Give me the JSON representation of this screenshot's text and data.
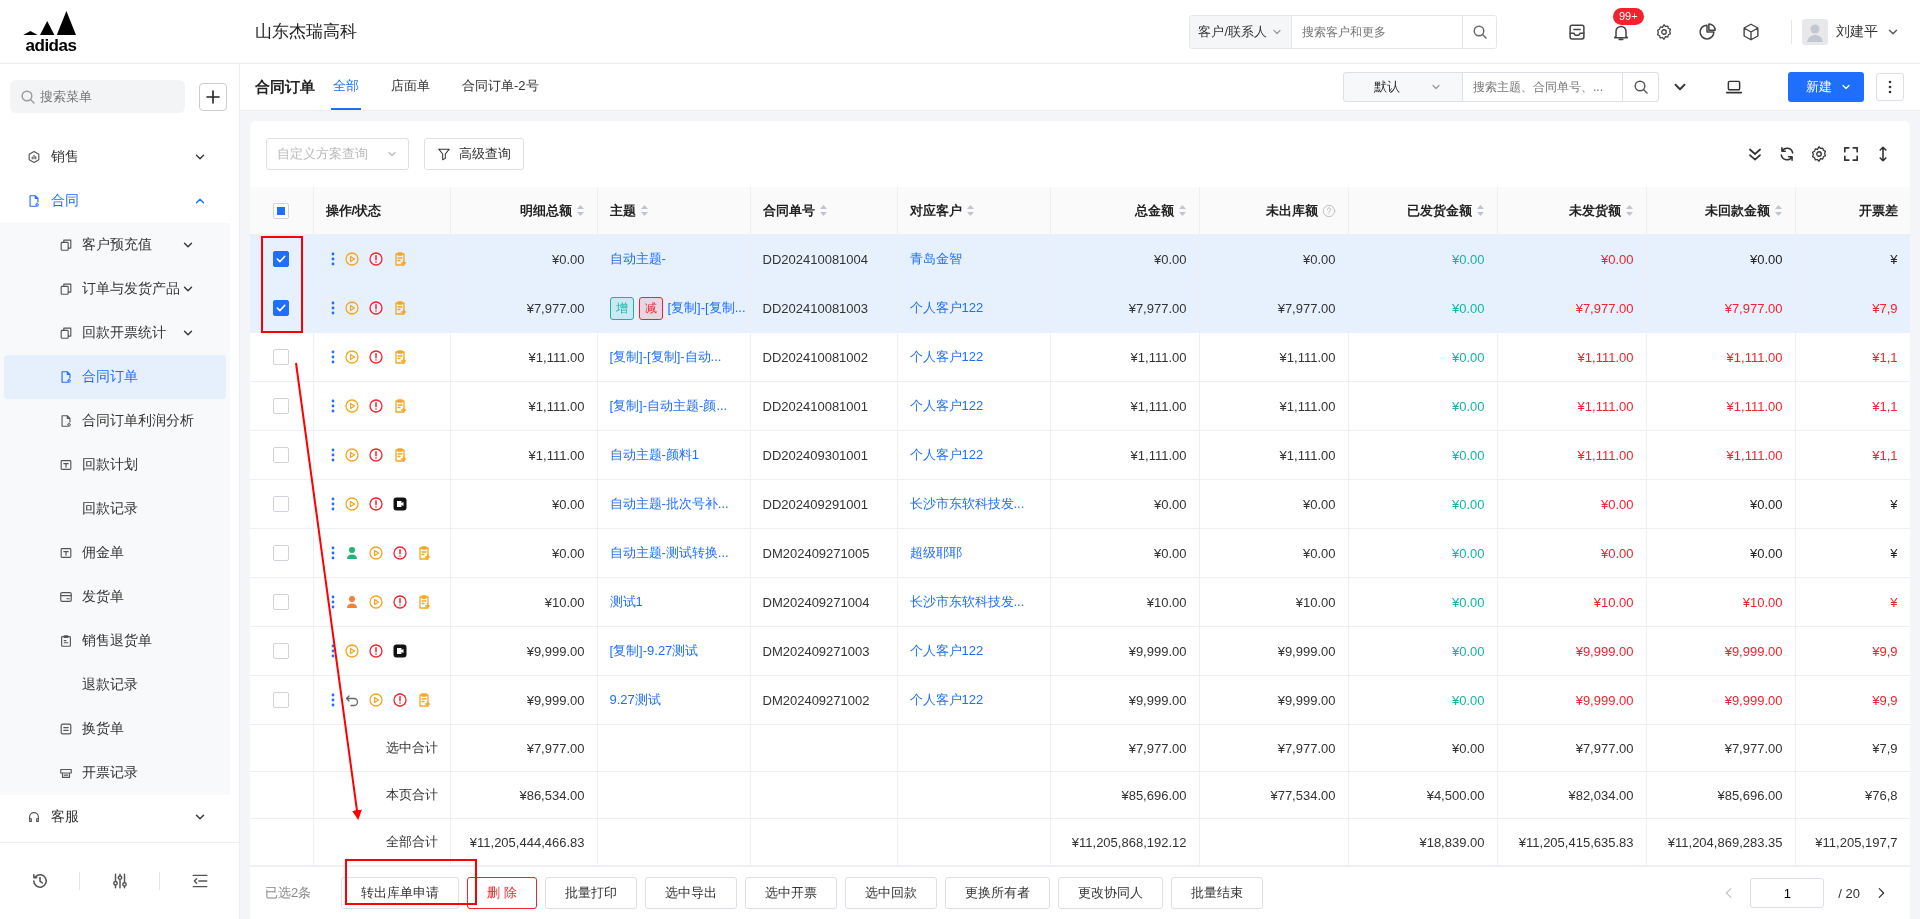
{
  "header": {
    "logo_text": "adidas",
    "company": "山东杰瑞高科",
    "search_scope": "客户/联系人",
    "search_placeholder": "搜索客户和更多",
    "notification_badge": "99+",
    "user_name": "刘建平"
  },
  "sidebar": {
    "search_placeholder": "搜索菜单",
    "items": [
      {
        "label": "销售",
        "expanded": false,
        "selected": false
      },
      {
        "label": "合同",
        "expanded": true,
        "selected": false,
        "children": [
          {
            "label": "客户预充值",
            "expanded": false,
            "selected": false
          },
          {
            "label": "订单与发货产品",
            "expanded": false,
            "selected": false
          },
          {
            "label": "回款开票统计",
            "expanded": false,
            "selected": false
          },
          {
            "label": "合同订单",
            "selected": true
          },
          {
            "label": "合同订单利润分析",
            "selected": false
          },
          {
            "label": "回款计划",
            "selected": false
          },
          {
            "label": "回款记录",
            "selected": false
          },
          {
            "label": "佣金单",
            "selected": false
          },
          {
            "label": "发货单",
            "selected": false
          },
          {
            "label": "销售退货单",
            "selected": false
          },
          {
            "label": "退款记录",
            "selected": false
          },
          {
            "label": "换货单",
            "selected": false
          },
          {
            "label": "开票记录",
            "selected": false
          }
        ]
      },
      {
        "label": "客服",
        "expanded": false,
        "selected": false
      }
    ]
  },
  "page": {
    "title": "合同订单",
    "tabs": [
      {
        "label": "全部",
        "selected": true
      },
      {
        "label": "店面单",
        "selected": false
      },
      {
        "label": "合同订单-2号",
        "selected": false
      }
    ],
    "view_select": "默认",
    "search_placeholder": "搜索主题、合同单号、...",
    "new_button": "新建"
  },
  "filters": {
    "scheme_placeholder": "自定义方案查询",
    "advanced_button": "高级查询"
  },
  "table": {
    "header_checkbox": {
      "indeterminate": true
    },
    "columns": [
      {
        "label": "操作/状态",
        "sortable": false
      },
      {
        "label": "明细总额",
        "sortable": true
      },
      {
        "label": "主题",
        "sortable": true
      },
      {
        "label": "合同单号",
        "sortable": true
      },
      {
        "label": "对应客户",
        "sortable": true
      },
      {
        "label": "总金额",
        "sortable": true
      },
      {
        "label": "未出库额",
        "sortable": false,
        "help": true
      },
      {
        "label": "已发货金额",
        "sortable": true
      },
      {
        "label": "未发货额",
        "sortable": true
      },
      {
        "label": "未回款金额",
        "sortable": true
      },
      {
        "label": "开票差",
        "sortable": false
      }
    ],
    "rows": [
      {
        "checked": true,
        "unpaid": false,
        "status_icons": [
          {
            "kind": "play"
          },
          {
            "kind": "alert"
          },
          {
            "kind": "doc"
          }
        ],
        "cells": [
          "",
          "¥0.00",
          "自动主题-",
          "DD202410081004",
          "青岛金智",
          "¥0.00",
          "¥0.00",
          "¥0.00",
          "¥0.00",
          "¥0.00",
          "¥"
        ]
      },
      {
        "checked": true,
        "unpaid": true,
        "status_icons": [
          {
            "kind": "play"
          },
          {
            "kind": "alert"
          },
          {
            "kind": "doc"
          }
        ],
        "tags": [
          {
            "text": "增",
            "color": "#13b5a8"
          },
          {
            "text": "减",
            "color": "#f5222d"
          }
        ],
        "cells": [
          "",
          "¥7,977.00",
          "[复制]-[复制...",
          "DD202410081003",
          "个人客户122",
          "¥7,977.00",
          "¥7,977.00",
          "¥0.00",
          "¥7,977.00",
          "¥7,977.00",
          "¥7,9"
        ]
      },
      {
        "checked": false,
        "unpaid": true,
        "status_icons": [
          {
            "kind": "play"
          },
          {
            "kind": "alert"
          },
          {
            "kind": "doc"
          }
        ],
        "cells": [
          "",
          "¥1,111.00",
          "[复制]-[复制]-自动...",
          "DD202410081002",
          "个人客户122",
          "¥1,111.00",
          "¥1,111.00",
          "¥0.00",
          "¥1,111.00",
          "¥1,111.00",
          "¥1,1"
        ]
      },
      {
        "checked": false,
        "unpaid": true,
        "status_icons": [
          {
            "kind": "play"
          },
          {
            "kind": "alert"
          },
          {
            "kind": "doc"
          }
        ],
        "cells": [
          "",
          "¥1,111.00",
          "[复制]-自动主题-颜...",
          "DD202410081001",
          "个人客户122",
          "¥1,111.00",
          "¥1,111.00",
          "¥0.00",
          "¥1,111.00",
          "¥1,111.00",
          "¥1,1"
        ]
      },
      {
        "checked": false,
        "unpaid": true,
        "status_icons": [
          {
            "kind": "play"
          },
          {
            "kind": "alert"
          },
          {
            "kind": "doc"
          }
        ],
        "cells": [
          "",
          "¥1,111.00",
          "自动主题-颜料1",
          "DD202409301001",
          "个人客户122",
          "¥1,111.00",
          "¥1,111.00",
          "¥0.00",
          "¥1,111.00",
          "¥1,111.00",
          "¥1,1"
        ]
      },
      {
        "checked": false,
        "unpaid": false,
        "status_icons": [
          {
            "kind": "play"
          },
          {
            "kind": "alert"
          },
          {
            "kind": "video"
          }
        ],
        "cells": [
          "",
          "¥0.00",
          "自动主题-批次号补...",
          "DD202409291001",
          "长沙市东软科技发...",
          "¥0.00",
          "¥0.00",
          "¥0.00",
          "¥0.00",
          "¥0.00",
          "¥"
        ]
      },
      {
        "checked": false,
        "unpaid": false,
        "status_icons": [
          {
            "kind": "person-green"
          },
          {
            "kind": "play"
          },
          {
            "kind": "alert"
          },
          {
            "kind": "doc"
          }
        ],
        "cells": [
          "",
          "¥0.00",
          "自动主题-测试转换...",
          "DM202409271005",
          "超级耶耶",
          "¥0.00",
          "¥0.00",
          "¥0.00",
          "¥0.00",
          "¥0.00",
          "¥"
        ]
      },
      {
        "checked": false,
        "unpaid": true,
        "status_icons": [
          {
            "kind": "person-orange"
          },
          {
            "kind": "play"
          },
          {
            "kind": "alert"
          },
          {
            "kind": "doc"
          }
        ],
        "cells": [
          "",
          "¥10.00",
          "测试1",
          "DM202409271004",
          "长沙市东软科技发...",
          "¥10.00",
          "¥10.00",
          "¥0.00",
          "¥10.00",
          "¥10.00",
          "¥"
        ]
      },
      {
        "checked": false,
        "unpaid": true,
        "status_icons": [
          {
            "kind": "play"
          },
          {
            "kind": "alert"
          },
          {
            "kind": "video"
          }
        ],
        "cells": [
          "",
          "¥9,999.00",
          "[复制]-9.27测试",
          "DM202409271003",
          "个人客户122",
          "¥9,999.00",
          "¥9,999.00",
          "¥0.00",
          "¥9,999.00",
          "¥9,999.00",
          "¥9,9"
        ]
      },
      {
        "checked": false,
        "unpaid": true,
        "status_icons": [
          {
            "kind": "undo"
          },
          {
            "kind": "play"
          },
          {
            "kind": "alert"
          },
          {
            "kind": "doc"
          }
        ],
        "cells": [
          "",
          "¥9,999.00",
          "9.27测试",
          "DM202409271002",
          "个人客户122",
          "¥9,999.00",
          "¥9,999.00",
          "¥0.00",
          "¥9,999.00",
          "¥9,999.00",
          "¥9,9"
        ]
      }
    ],
    "summary": [
      {
        "cells": [
          "选中合计",
          "¥7,977.00",
          "",
          "",
          "",
          "¥7,977.00",
          "¥7,977.00",
          "¥0.00",
          "¥7,977.00",
          "¥7,977.00",
          "¥7,9"
        ]
      },
      {
        "cells": [
          "本页合计",
          "¥86,534.00",
          "",
          "",
          "",
          "¥85,696.00",
          "¥77,534.00",
          "¥4,500.00",
          "¥82,034.00",
          "¥85,696.00",
          "¥76,8"
        ]
      },
      {
        "cells": [
          "全部合计",
          "¥11,205,444,466.83",
          "",
          "",
          "",
          "¥11,205,868,192.12",
          "",
          "¥18,839.00",
          "¥11,205,415,635.83",
          "¥11,204,869,283.35",
          "¥11,205,197,7"
        ]
      }
    ]
  },
  "bulk_bar": {
    "selected_count": "已选2条",
    "buttons": [
      {
        "label": "转出库单申请",
        "kind": "default"
      },
      {
        "label": "删 除",
        "kind": "danger"
      },
      {
        "label": "批量打印",
        "kind": "default"
      },
      {
        "label": "选中导出",
        "kind": "default"
      },
      {
        "label": "选中开票",
        "kind": "default"
      },
      {
        "label": "选中回款",
        "kind": "default"
      },
      {
        "label": "更换所有者",
        "kind": "default"
      },
      {
        "label": "更改协同人",
        "kind": "default"
      },
      {
        "label": "批量结束",
        "kind": "default"
      }
    ],
    "pagination": {
      "page": "1",
      "total": "/ 20"
    }
  }
}
